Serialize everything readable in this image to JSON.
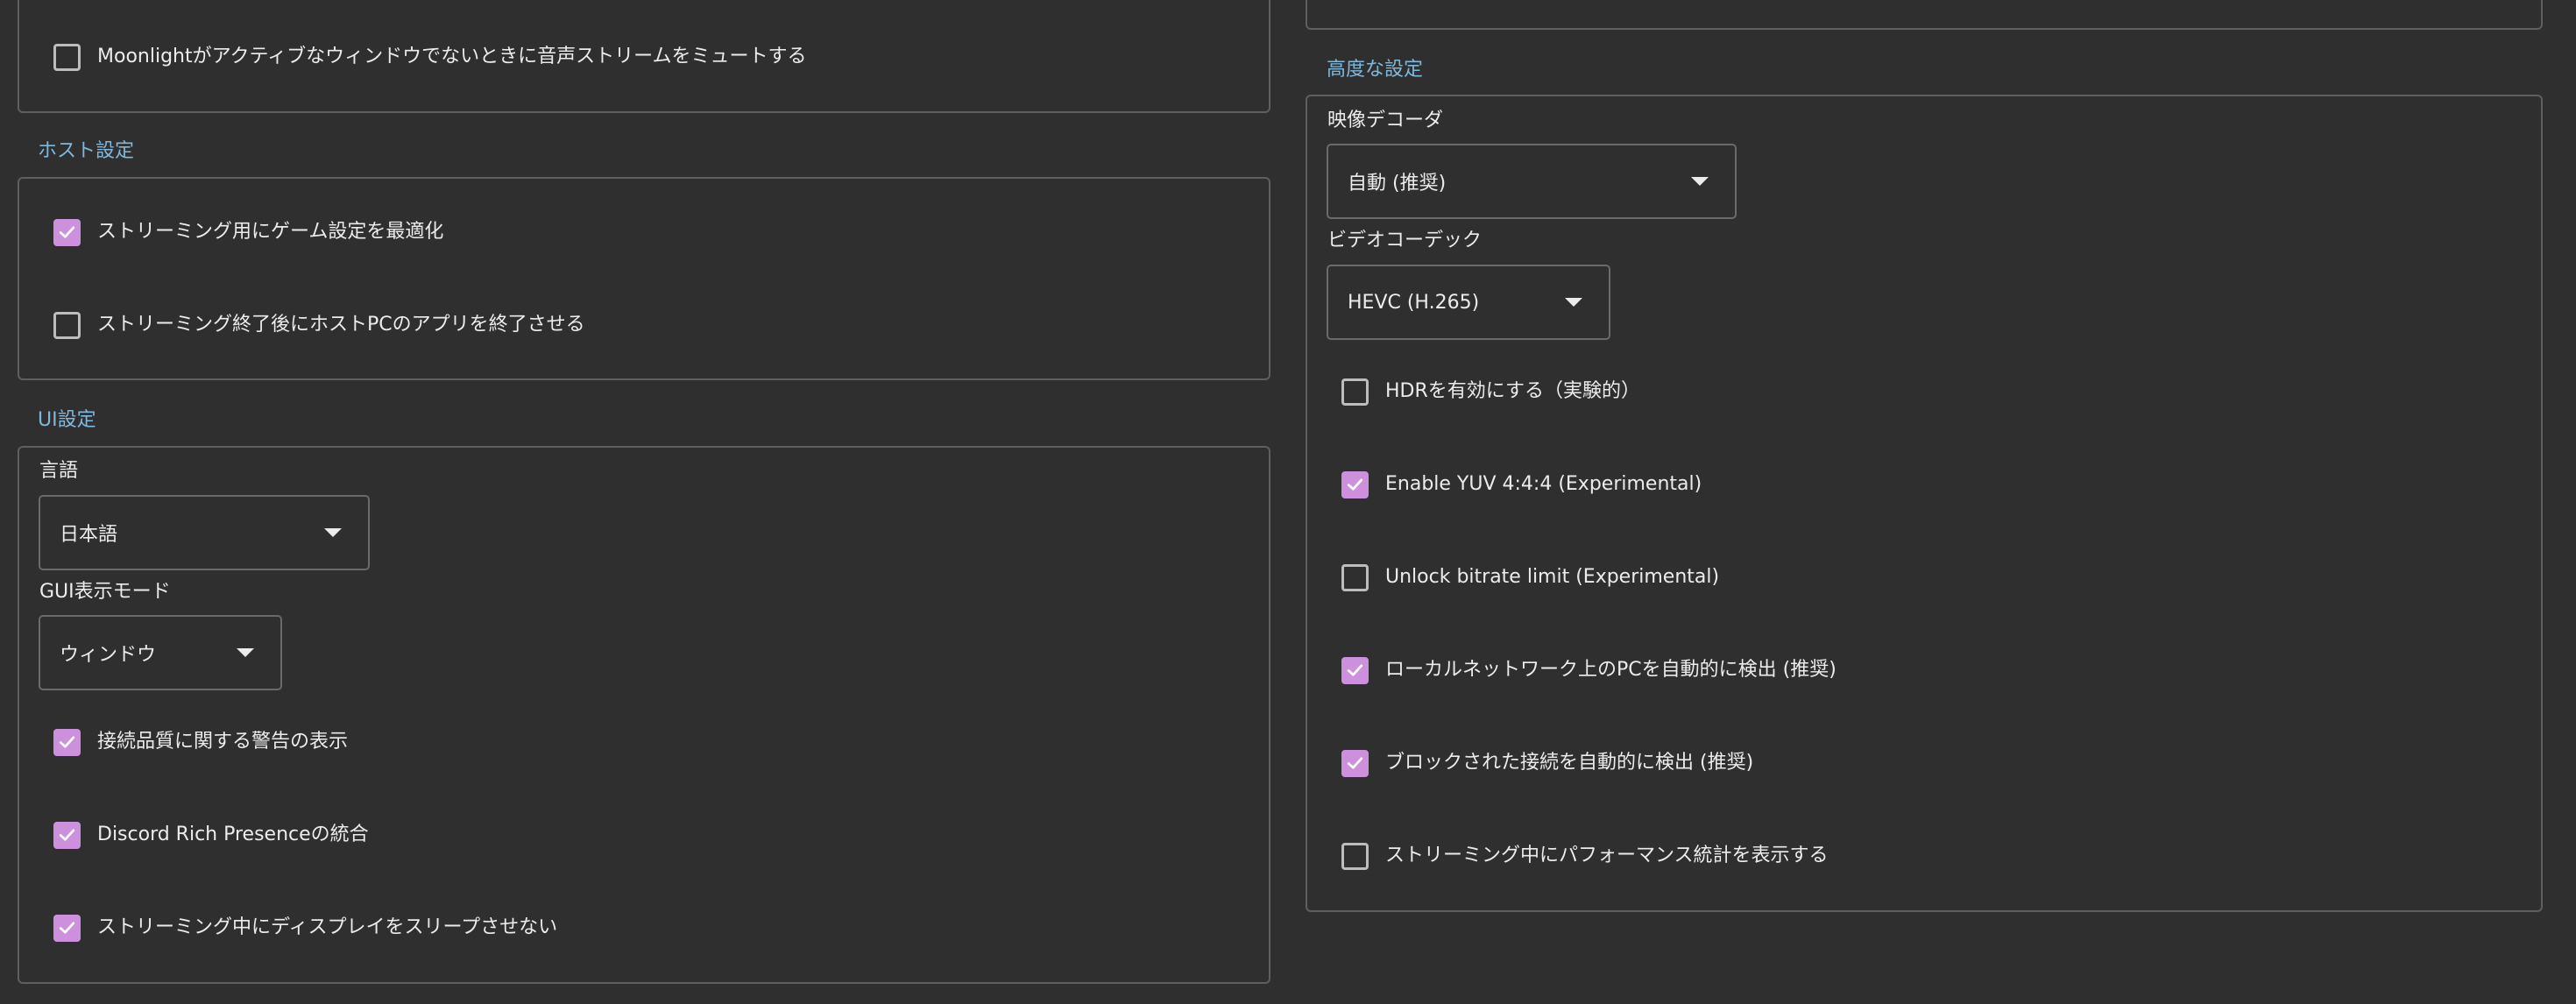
{
  "audio": {
    "mute_on_inactive_label": "Moonlightがアクティブなウィンドウでないときに音声ストリームをミュートする",
    "mute_on_inactive_checked": false
  },
  "host": {
    "title": "ホスト設定",
    "optimize_game_settings_label": "ストリーミング用にゲーム設定を最適化",
    "optimize_game_settings_checked": true,
    "quit_app_after_label": "ストリーミング終了後にホストPCのアプリを終了させる",
    "quit_app_after_checked": false
  },
  "ui": {
    "title": "UI設定",
    "language_label": "言語",
    "language_value": "日本語",
    "gui_mode_label": "GUI表示モード",
    "gui_mode_value": "ウィンドウ",
    "connection_warnings_label": "接続品質に関する警告の表示",
    "connection_warnings_checked": true,
    "discord_label": "Discord Rich Presenceの統合",
    "discord_checked": true,
    "keep_awake_label": "ストリーミング中にディスプレイをスリープさせない",
    "keep_awake_checked": true
  },
  "advanced": {
    "title": "高度な設定",
    "decoder_label": "映像デコーダ",
    "decoder_value": "自動 (推奨)",
    "codec_label": "ビデオコーデック",
    "codec_value": "HEVC (H.265)",
    "hdr_label": "HDRを有効にする（実験的）",
    "hdr_checked": false,
    "yuv444_label": "Enable YUV 4:4:4 (Experimental)",
    "yuv444_checked": true,
    "unlock_bitrate_label": "Unlock bitrate limit (Experimental)",
    "unlock_bitrate_checked": false,
    "detect_local_pcs_label": "ローカルネットワーク上のPCを自動的に検出 (推奨)",
    "detect_local_pcs_checked": true,
    "detect_blocked_label": "ブロックされた接続を自動的に検出 (推奨)",
    "detect_blocked_checked": true,
    "show_perf_stats_label": "ストリーミング中にパフォーマンス統計を表示する",
    "show_perf_stats_checked": false
  },
  "colors": {
    "background": "#2f2f2f",
    "section_title": "#7fb8db",
    "checkbox_checked": "#cc90dc",
    "border": "#5f5f5f"
  }
}
